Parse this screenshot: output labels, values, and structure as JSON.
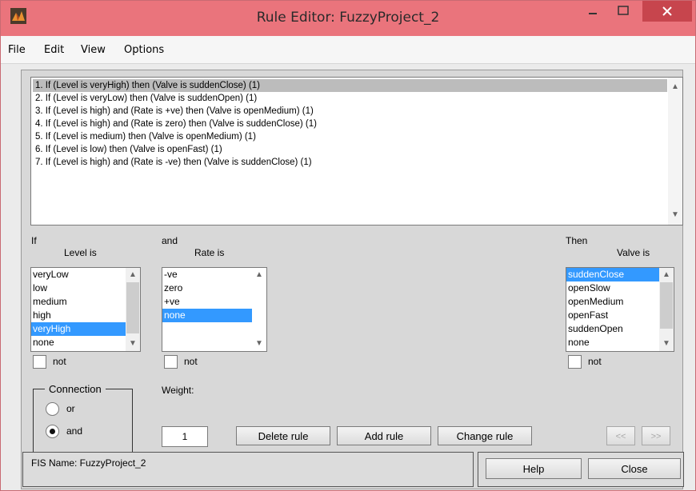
{
  "window": {
    "title": "Rule Editor: FuzzyProject_2",
    "accent": "#ea747c"
  },
  "menu": [
    "File",
    "Edit",
    "View",
    "Options"
  ],
  "rules": [
    "1. If (Level is veryHigh) then (Valve is suddenClose) (1)",
    "2. If (Level is veryLow) then (Valve is suddenOpen) (1)",
    "3. If (Level is high) and (Rate is +ve) then (Valve is openMedium) (1)",
    "4. If (Level is high) and (Rate is zero) then (Valve is suddenClose) (1)",
    "5. If (Level is medium) then (Valve is openMedium) (1)",
    "6. If (Level is low) then (Valve is openFast) (1)",
    "7. If (Level is high) and (Rate is -ve) then (Valve is suddenClose) (1)"
  ],
  "selected_rule": 0,
  "if_section": {
    "header": "If",
    "var_label": "Level is",
    "options": [
      "veryLow",
      "low",
      "medium",
      "high",
      "veryHigh",
      "none"
    ],
    "selected": 4,
    "not_label": "not"
  },
  "and_section": {
    "header": "and",
    "var_label": "Rate is",
    "options": [
      "-ve",
      "zero",
      "+ve",
      "none"
    ],
    "selected": 3,
    "not_label": "not"
  },
  "then_section": {
    "header": "Then",
    "var_label": "Valve is",
    "options": [
      "suddenClose",
      "openSlow",
      "openMedium",
      "openFast",
      "suddenOpen",
      "none"
    ],
    "selected": 0,
    "not_label": "not"
  },
  "connection": {
    "title": "Connection",
    "or_label": "or",
    "and_label": "and",
    "selected": "and"
  },
  "weight": {
    "label": "Weight:",
    "value": "1"
  },
  "buttons": {
    "delete": "Delete rule",
    "add": "Add rule",
    "change": "Change rule",
    "prev": "<<",
    "next": ">>",
    "help": "Help",
    "close": "Close"
  },
  "status": "FIS Name: FuzzyProject_2"
}
